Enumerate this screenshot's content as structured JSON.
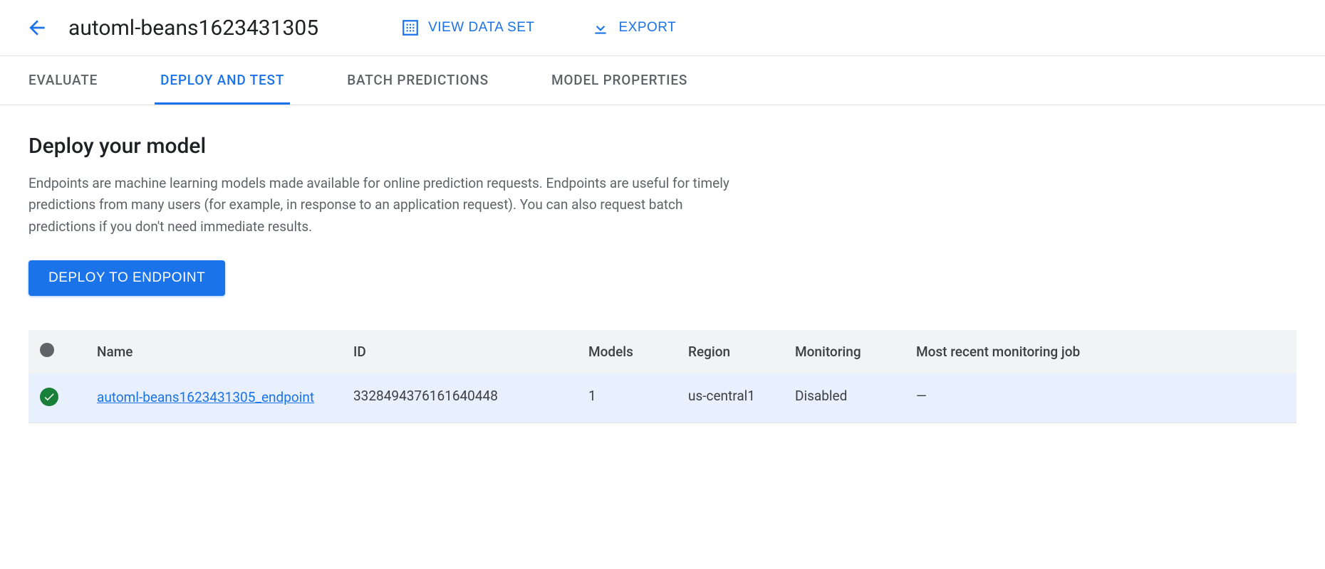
{
  "header": {
    "title": "automl-beans1623431305",
    "actions": {
      "view_dataset": "VIEW DATA SET",
      "export": "EXPORT"
    }
  },
  "tabs": {
    "evaluate": "EVALUATE",
    "deploy_and_test": "DEPLOY AND TEST",
    "batch_predictions": "BATCH PREDICTIONS",
    "model_properties": "MODEL PROPERTIES"
  },
  "section": {
    "title": "Deploy your model",
    "description": "Endpoints are machine learning models made available for online prediction requests. Endpoints are useful for timely predictions from many users (for example, in response to an application request). You can also request batch predictions if you don't need immediate results.",
    "deploy_button": "DEPLOY TO ENDPOINT"
  },
  "table": {
    "columns": {
      "name": "Name",
      "id": "ID",
      "models": "Models",
      "region": "Region",
      "monitoring": "Monitoring",
      "recent_job": "Most recent monitoring job"
    },
    "rows": [
      {
        "status": "ready",
        "name": "automl-beans1623431305_endpoint",
        "id": "3328494376161640448",
        "models": "1",
        "region": "us-central1",
        "monitoring": "Disabled",
        "recent_job": "—"
      }
    ]
  }
}
